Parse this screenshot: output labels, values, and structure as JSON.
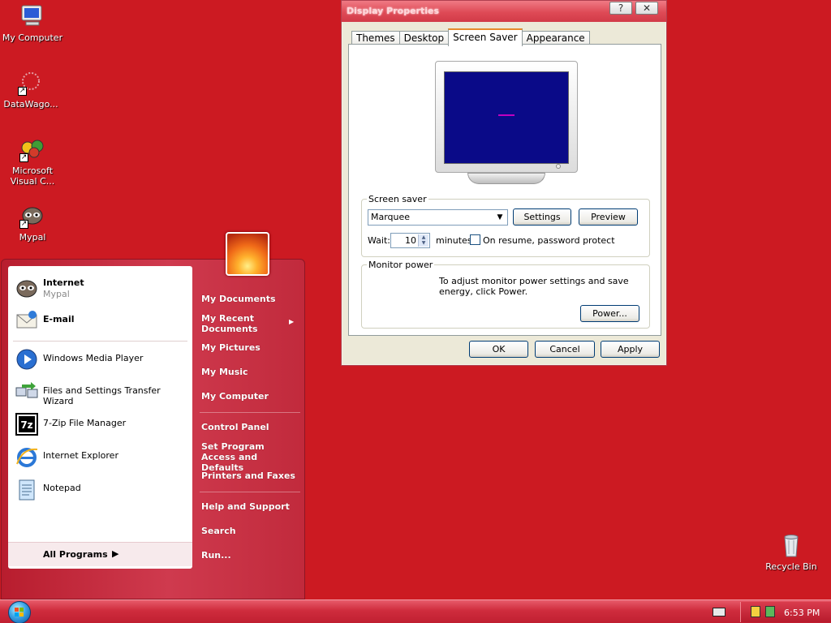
{
  "desktop_icons": [
    {
      "label": "My Computer",
      "icon": "my-computer-icon"
    },
    {
      "label": "DataWago...",
      "icon": "datawagon-icon"
    },
    {
      "label": "Microsoft Visual C...",
      "icon": "visual-studio-icon"
    },
    {
      "label": "Mypal",
      "icon": "mypal-icon"
    },
    {
      "label": "Recycle Bin",
      "icon": "recycle-bin-icon"
    }
  ],
  "display_properties": {
    "title": "Display Properties",
    "help_glyph": "?",
    "close_glyph": "✕",
    "tabs": [
      "Themes",
      "Desktop",
      "Screen Saver",
      "Appearance"
    ],
    "active_tab": "Screen Saver",
    "screen_saver": {
      "group_label": "Screen saver",
      "selected": "Marquee",
      "settings_label": "Settings",
      "preview_label": "Preview",
      "wait_label": "Wait:",
      "wait_value": "10",
      "minutes_label": "minutes",
      "password_label": "On resume, password protect",
      "password_checked": false
    },
    "monitor_power": {
      "group_label": "Monitor power",
      "description": "To adjust monitor power settings and save energy, click Power.",
      "power_label": "Power..."
    },
    "buttons": {
      "ok": "OK",
      "cancel": "Cancel",
      "apply": "Apply"
    }
  },
  "start_menu": {
    "pinned": [
      {
        "label": "Internet",
        "sub": "Mypal",
        "icon": "mypal-icon"
      },
      {
        "label": "E-mail",
        "icon": "email-icon"
      }
    ],
    "recent": [
      {
        "label": "Windows Media Player",
        "icon": "media-player-icon"
      },
      {
        "label": "Files and Settings Transfer Wizard",
        "icon": "transfer-wizard-icon"
      },
      {
        "label": "7-Zip File Manager",
        "icon": "7zip-icon"
      },
      {
        "label": "Internet Explorer",
        "icon": "internet-explorer-icon"
      },
      {
        "label": "Notepad",
        "icon": "notepad-icon"
      }
    ],
    "all_programs": "All Programs",
    "right_items": [
      "My Documents",
      "My Recent Documents",
      "My Pictures",
      "My Music",
      "My Computer",
      "Control Panel",
      "Set Program Access and Defaults",
      "Printers and Faxes",
      "Help and Support",
      "Search",
      "Run..."
    ]
  },
  "taskbar": {
    "clock": "6:53 PM"
  },
  "colors": {
    "desktop": "#cc1a22",
    "start_menu_right": "#cf3a4e",
    "taskbar": "#cf2c3d",
    "window_face": "#ece9d8"
  }
}
